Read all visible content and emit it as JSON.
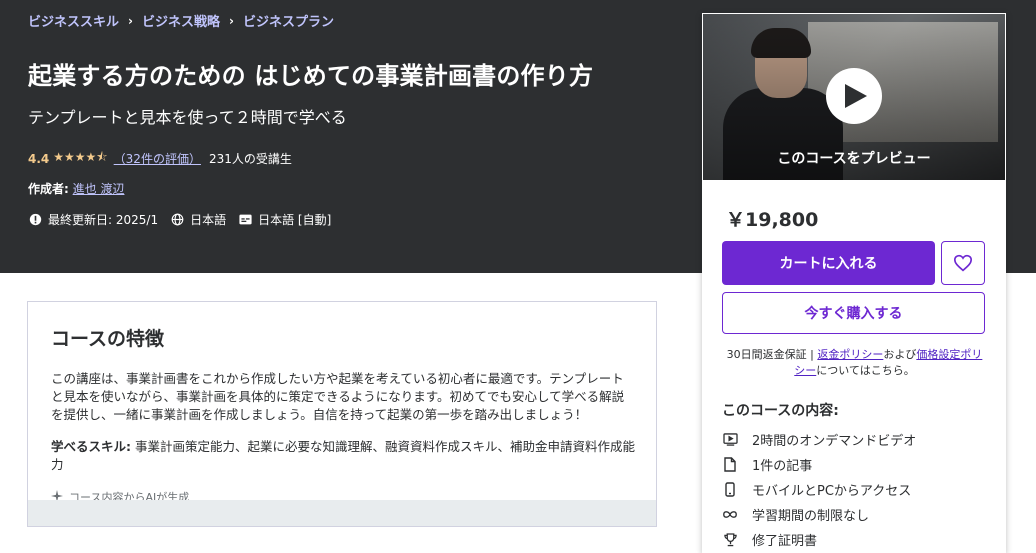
{
  "breadcrumb": [
    "ビジネススキル",
    "ビジネス戦略",
    "ビジネスプラン"
  ],
  "course": {
    "title": "起業する方のための はじめての事業計画書の作り方",
    "subtitle": "テンプレートと見本を使って２時間で学べる",
    "rating": "4.4",
    "stars": "★★★★⯪",
    "rating_count": "（32件の評価）",
    "students": "231人の受講生",
    "author_label": "作成者:",
    "author_name": "進也 渡辺",
    "last_updated": "最終更新日: 2025/1",
    "language": "日本語",
    "captions": "日本語 [自動]"
  },
  "sidebar": {
    "preview_label": "このコースをプレビュー",
    "price": "￥19,800",
    "cart_button": "カートに入れる",
    "buy_button": "今すぐ購入する",
    "guarantee_prefix": "30日間返金保証 | ",
    "refund_policy": "返金ポリシー",
    "and": "および",
    "pricing_policy": "価格設定ポリシー",
    "suffix": "についてはこちら。",
    "includes_heading": "このコースの内容:",
    "includes": [
      {
        "icon": "video-icon",
        "label": "2時間のオンデマンドビデオ"
      },
      {
        "icon": "file-icon",
        "label": "1件の記事"
      },
      {
        "icon": "mobile-icon",
        "label": "モバイルとPCからアクセス"
      },
      {
        "icon": "infinity-icon",
        "label": "学習期間の制限なし"
      },
      {
        "icon": "trophy-icon",
        "label": "修了証明書"
      }
    ]
  },
  "features": {
    "heading": "コースの特徴",
    "description": "この講座は、事業計画書をこれから作成したい方や起業を考えている初心者に最適です。テンプレートと見本を使いながら、事業計画を具体的に策定できるようになります。初めてでも安心して学べる解説を提供し、一緒に事業計画を作成しましょう。自信を持って起業の第一歩を踏み出しましょう！",
    "skills_label": "学べるスキル:",
    "skills": " 事業計画策定能力、起業に必要な知識理解、融資資料作成スキル、補助金申請資料作成能力",
    "ai_note": "コース内容からAIが生成"
  },
  "colors": {
    "hero_bg": "#2d2f31",
    "accent": "#6d28d2",
    "link": "#c0c4fc",
    "star": "#f3ca8c"
  }
}
